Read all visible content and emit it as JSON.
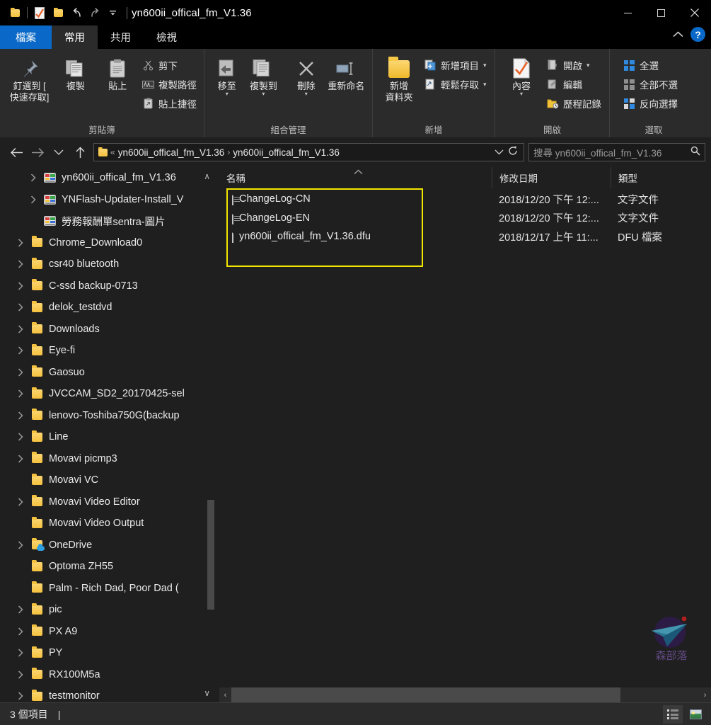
{
  "window": {
    "title": "yn600ii_offical_fm_V1.36",
    "quick_access": [
      {
        "name": "folder-icon",
        "label": "檔案總管"
      },
      {
        "name": "properties-icon",
        "label": "內容"
      },
      {
        "name": "new-folder-icon",
        "label": "新增資料夾"
      },
      {
        "name": "undo-icon",
        "label": "復原"
      },
      {
        "name": "redo-icon",
        "label": "重做"
      },
      {
        "name": "customize-qat-icon",
        "label": "自訂快速存取工具列"
      }
    ],
    "controls": {
      "minimize": "─",
      "maximize": "□",
      "close": "✕"
    }
  },
  "ribbon": {
    "tabs": [
      {
        "label": "檔案",
        "state": "file"
      },
      {
        "label": "常用",
        "state": "active"
      },
      {
        "label": "共用",
        "state": "normal"
      },
      {
        "label": "檢視",
        "state": "normal"
      }
    ],
    "collapse_label": "∧",
    "help_label": "?",
    "groups": [
      {
        "label": "剪貼簿",
        "big_buttons": [
          {
            "label": "釘選到 [\n快速存取]",
            "line1": "釘選到 [",
            "line2": "快速存取]",
            "icon": "pin-icon"
          },
          {
            "label": "複製",
            "icon": "copy-icon"
          },
          {
            "label": "貼上",
            "icon": "paste-icon"
          }
        ],
        "small_buttons": [
          {
            "label": "剪下",
            "icon": "scissors-icon"
          },
          {
            "label": "複製路徑",
            "icon": "copy-path-icon"
          },
          {
            "label": "貼上捷徑",
            "icon": "paste-shortcut-icon"
          }
        ]
      },
      {
        "label": "組合管理",
        "big_buttons": [
          {
            "label": "移至",
            "icon": "move-to-icon",
            "dropdown": true
          },
          {
            "label": "複製到",
            "icon": "copy-to-icon",
            "dropdown": true
          },
          {
            "label": "刪除",
            "icon": "delete-icon",
            "dropdown": true
          },
          {
            "label": "重新命名",
            "icon": "rename-icon"
          }
        ],
        "small_buttons": []
      },
      {
        "label": "新增",
        "big_buttons": [
          {
            "label": "新增\n資料夾",
            "line1": "新增",
            "line2": "資料夾",
            "icon": "new-folder-icon"
          }
        ],
        "small_buttons": [
          {
            "label": "新增項目",
            "icon": "new-item-icon",
            "dropdown": true
          },
          {
            "label": "輕鬆存取",
            "icon": "easy-access-icon",
            "dropdown": true
          }
        ]
      },
      {
        "label": "開啟",
        "big_buttons": [
          {
            "label": "內容",
            "icon": "properties-icon",
            "dropdown": true
          }
        ],
        "small_buttons": [
          {
            "label": "開啟",
            "icon": "open-icon",
            "dropdown": true
          },
          {
            "label": "編輯",
            "icon": "edit-icon"
          },
          {
            "label": "歷程記錄",
            "icon": "history-icon"
          }
        ]
      },
      {
        "label": "選取",
        "big_buttons": [],
        "small_buttons": [
          {
            "label": "全選",
            "icon": "select-all-icon"
          },
          {
            "label": "全部不選",
            "icon": "select-none-icon"
          },
          {
            "label": "反向選擇",
            "icon": "invert-selection-icon"
          }
        ]
      }
    ]
  },
  "addressbar": {
    "back_icon": "←",
    "forward_icon": "→",
    "recent_icon": "⌄",
    "up_icon": "↑",
    "folder_icon": "folder-icon",
    "overflow": "«",
    "crumbs": [
      "yn600ii_offical_fm_V1.36",
      "yn600ii_offical_fm_V1.36"
    ],
    "separator": "›",
    "dropdown": "⌄",
    "refresh": "↻"
  },
  "search": {
    "placeholder": "搜尋 yn600ii_offical_fm_V1.36",
    "icon": "search-icon"
  },
  "navpane": {
    "scroll_up": "∧",
    "scroll_down": "∨",
    "items": [
      {
        "label": "yn600ii_offical_fm_V1.36",
        "icon": "archive-icon",
        "expandable": true,
        "indent": true
      },
      {
        "label": "YNFlash-Updater-Install_V",
        "icon": "archive-icon",
        "expandable": true,
        "indent": true
      },
      {
        "label": "勞務報酬單sentra-圖片",
        "icon": "archive-icon",
        "expandable": false,
        "indent": true
      },
      {
        "label": "Chrome_Download0",
        "icon": "folder-icon",
        "expandable": true,
        "indent": false
      },
      {
        "label": "csr40 bluetooth",
        "icon": "folder-icon",
        "expandable": true,
        "indent": false
      },
      {
        "label": "C-ssd backup-0713",
        "icon": "folder-icon",
        "expandable": true,
        "indent": false
      },
      {
        "label": "delok_testdvd",
        "icon": "folder-icon",
        "expandable": true,
        "indent": false
      },
      {
        "label": "Downloads",
        "icon": "folder-icon",
        "expandable": true,
        "indent": false
      },
      {
        "label": "Eye-fi",
        "icon": "folder-icon",
        "expandable": true,
        "indent": false
      },
      {
        "label": "Gaosuo",
        "icon": "folder-icon",
        "expandable": true,
        "indent": false
      },
      {
        "label": "JVCCAM_SD2_20170425-sel",
        "icon": "folder-icon",
        "expandable": true,
        "indent": false
      },
      {
        "label": "lenovo-Toshiba750G(backup",
        "icon": "folder-icon",
        "expandable": true,
        "indent": false
      },
      {
        "label": "Line",
        "icon": "folder-icon",
        "expandable": true,
        "indent": false
      },
      {
        "label": "Movavi picmp3",
        "icon": "folder-icon",
        "expandable": true,
        "indent": false
      },
      {
        "label": "Movavi VC",
        "icon": "folder-icon",
        "expandable": false,
        "indent": false
      },
      {
        "label": "Movavi Video Editor",
        "icon": "folder-icon",
        "expandable": true,
        "indent": false
      },
      {
        "label": "Movavi Video Output",
        "icon": "folder-icon",
        "expandable": false,
        "indent": false
      },
      {
        "label": "OneDrive",
        "icon": "onedrive-icon",
        "expandable": true,
        "indent": false
      },
      {
        "label": "Optoma ZH55",
        "icon": "folder-icon",
        "expandable": false,
        "indent": false
      },
      {
        "label": "Palm - Rich Dad, Poor Dad (",
        "icon": "folder-icon",
        "expandable": false,
        "indent": false
      },
      {
        "label": "pic",
        "icon": "folder-icon",
        "expandable": true,
        "indent": false
      },
      {
        "label": "PX A9",
        "icon": "folder-icon",
        "expandable": true,
        "indent": false
      },
      {
        "label": "PY",
        "icon": "folder-icon",
        "expandable": true,
        "indent": false
      },
      {
        "label": "RX100M5a",
        "icon": "folder-icon",
        "expandable": true,
        "indent": false
      },
      {
        "label": "testmonitor",
        "icon": "folder-icon",
        "expandable": true,
        "indent": false
      }
    ]
  },
  "filelist": {
    "sort_indicator": "∧",
    "columns": [
      {
        "label": "名稱",
        "key": "name"
      },
      {
        "label": "修改日期",
        "key": "date"
      },
      {
        "label": "類型",
        "key": "type"
      }
    ],
    "rows": [
      {
        "name": "ChangeLog-CN",
        "date": "2018/12/20 下午 12:...",
        "type": "文字文件",
        "icon": "text-file-icon"
      },
      {
        "name": "ChangeLog-EN",
        "date": "2018/12/20 下午 12:...",
        "type": "文字文件",
        "icon": "text-file-icon"
      },
      {
        "name": "yn600ii_offical_fm_V1.36.dfu",
        "date": "2018/12/17 上午 11:...",
        "type": "DFU 檔案",
        "icon": "generic-file-icon"
      }
    ],
    "highlight_color": "#f2e600",
    "hscroll": {
      "left_arrow": "‹",
      "right_arrow": "›"
    }
  },
  "watermark": {
    "text": "森部落"
  },
  "statusbar": {
    "item_count": "3 個項目",
    "cursor": "|",
    "views": [
      {
        "name": "details-view",
        "label": "詳細資料",
        "active": true
      },
      {
        "name": "thumbnail-view",
        "label": "大圖示",
        "active": false
      }
    ]
  }
}
